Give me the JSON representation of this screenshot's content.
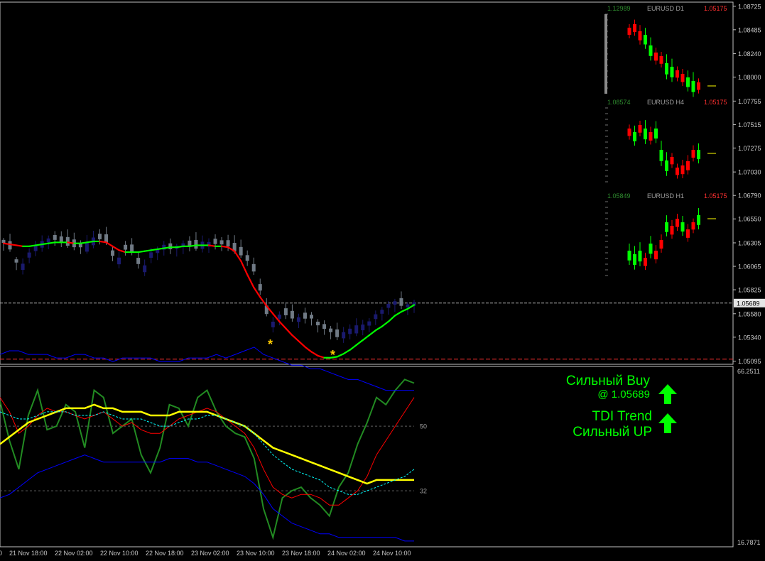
{
  "chart_data": [
    {
      "type": "candlestick",
      "symbol_timeframe": "",
      "price_scale": [
        "1.08725",
        "1.08485",
        "1.08240",
        "1.08000",
        "1.07755",
        "1.07515",
        "1.07275",
        "1.07030",
        "1.06790",
        "1.06550",
        "1.06305",
        "1.06065",
        "1.05825",
        "1.05580",
        "1.05340",
        "1.05095"
      ],
      "price_range": [
        1.0507,
        1.0876
      ],
      "current_price": "1.05689",
      "resistance_price": 1.05689,
      "support_price": 1.05115,
      "time_labels": [
        "0",
        "21 Nov 18:00",
        "22 Nov 02:00",
        "22 Nov 10:00",
        "22 Nov 18:00",
        "23 Nov 02:00",
        "23 Nov 10:00",
        "23 Nov 18:00",
        "24 Nov 02:00",
        "24 Nov 10:00"
      ],
      "ma_line": {
        "up_color": "#00ff00",
        "down_color": "#ff0000"
      },
      "candles_color": {
        "bull": "#1a1a6e",
        "bear": "#707a85"
      },
      "signal_marks": [
        "*",
        "*"
      ]
    },
    {
      "type": "line",
      "title": "TDI",
      "scale_top": "66.2511",
      "scale_bottom": "16.7871",
      "levels": [
        "50",
        "32"
      ],
      "range": [
        16.7871,
        66.2511
      ],
      "series": [
        {
          "color": "#228b22",
          "values": [
            57,
            46,
            38,
            53,
            60,
            49,
            50,
            56,
            54,
            44,
            60,
            58,
            48,
            50,
            52,
            42,
            37,
            44,
            56,
            55,
            50,
            58,
            60,
            54,
            50,
            48,
            47,
            41,
            27,
            19,
            30,
            32,
            33,
            30,
            28,
            25,
            33,
            37,
            45,
            51,
            58,
            56,
            60,
            63,
            62
          ]
        },
        {
          "color": "#ff0000",
          "values": [
            58,
            54,
            48,
            50,
            53,
            55,
            54,
            54,
            53,
            52,
            53,
            54,
            52,
            50,
            51,
            49,
            48,
            48,
            50,
            52,
            53,
            54,
            55,
            54,
            52,
            50,
            48,
            44,
            38,
            33,
            31,
            30,
            31,
            31,
            30,
            28,
            28,
            30,
            32,
            36,
            42,
            46,
            50,
            54,
            58
          ]
        },
        {
          "color": "#ffff00",
          "values": [
            45,
            47,
            49,
            51,
            52,
            53,
            54,
            55,
            55,
            55,
            56,
            55,
            55,
            54,
            54,
            54,
            53,
            53,
            53,
            54,
            54,
            54,
            54,
            53,
            52,
            51,
            50,
            48,
            46,
            44,
            43,
            42,
            41,
            40,
            39,
            38,
            37,
            36,
            35,
            34,
            35,
            35,
            35,
            35,
            35
          ]
        },
        {
          "color": "#00ffff",
          "values": [
            54,
            53,
            52,
            52,
            53,
            54,
            54,
            54,
            53,
            53,
            53,
            54,
            53,
            52,
            52,
            52,
            51,
            50,
            50,
            51,
            52,
            52,
            53,
            53,
            52,
            51,
            50,
            48,
            45,
            42,
            40,
            38,
            37,
            36,
            35,
            33,
            32,
            31,
            31,
            32,
            33,
            34,
            35,
            36,
            38
          ]
        },
        {
          "color": "#0000ff",
          "values": [
            70,
            71,
            71,
            70,
            70,
            70,
            69,
            69,
            70,
            70,
            69,
            69,
            68,
            69,
            69,
            69,
            69,
            68,
            68,
            68,
            69,
            69,
            69,
            70,
            69,
            70,
            71,
            72,
            70,
            69,
            68,
            67,
            67,
            66,
            66,
            65,
            64,
            63,
            63,
            62,
            61,
            60,
            60,
            60,
            60
          ]
        },
        {
          "color": "#0000ff",
          "values": [
            30,
            31,
            33,
            35,
            37,
            38,
            39,
            40,
            41,
            42,
            41,
            40,
            40,
            40,
            40,
            40,
            40,
            40,
            41,
            41,
            41,
            40,
            40,
            39,
            38,
            37,
            36,
            34,
            31,
            27,
            25,
            23,
            22,
            21,
            20,
            20,
            19,
            19,
            19,
            19,
            19,
            19,
            19,
            18,
            18
          ]
        }
      ]
    },
    {
      "type": "candlestick",
      "symbol_timeframe": "EURUSD D1",
      "high_label": "1.12989",
      "current_label": "1.05175"
    },
    {
      "type": "candlestick",
      "symbol_timeframe": "EURUSD H4",
      "high_label": "1.08574",
      "current_label": "1.05175"
    },
    {
      "type": "candlestick",
      "symbol_timeframe": "EURUSD H1",
      "high_label": "1.05849",
      "current_label": "1.05175"
    }
  ],
  "signal": {
    "line1": "Сильный Buy",
    "line2": "@ 1.05689",
    "line3": "TDI Trend",
    "line4": "Сильный UP",
    "color": "#00ff00"
  }
}
